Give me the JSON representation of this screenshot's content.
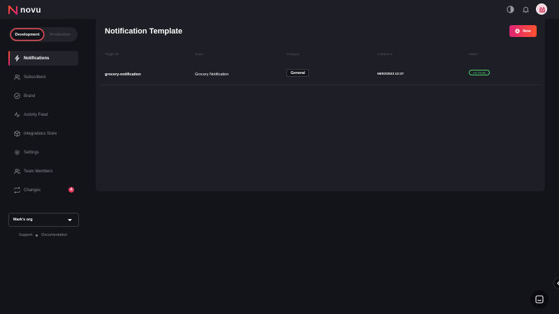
{
  "app": {
    "brand": "novu"
  },
  "header": {
    "icons": [
      "theme-toggle-icon",
      "bell-icon",
      "avatar"
    ]
  },
  "environment": {
    "options": [
      "Development",
      "Production"
    ],
    "selected": "Development"
  },
  "sidebar": {
    "items": [
      {
        "label": "Notifications",
        "icon": "lightning-icon",
        "active": true
      },
      {
        "label": "Subscribers",
        "icon": "users-icon"
      },
      {
        "label": "Brand",
        "icon": "check-circle-icon"
      },
      {
        "label": "Activity Feed",
        "icon": "activity-icon"
      },
      {
        "label": "Integrations Store",
        "icon": "box-icon"
      },
      {
        "label": "Settings",
        "icon": "gear-icon"
      },
      {
        "label": "Team Members",
        "icon": "team-icon"
      },
      {
        "label": "Changes",
        "icon": "swap-icon",
        "badge": "4"
      }
    ],
    "org": {
      "name": "Mark's org"
    },
    "footer": {
      "support": "Support",
      "documentation": "Documentation"
    }
  },
  "main": {
    "title": "Notification Template",
    "new_button": "New",
    "table": {
      "columns": [
        "Trigger ID",
        "Name",
        "Category",
        "Created At",
        "Status"
      ],
      "rows": [
        {
          "trigger_id": "grocery-notification",
          "name": "Grocery Notification",
          "category": "General",
          "created_at": "06/02/2023 12:37",
          "status": "ACTIVE"
        }
      ]
    }
  },
  "colors": {
    "accent_start": "#dd2476",
    "accent_end": "#ff512f",
    "status_active": "#4dd26e",
    "background": "#13131a",
    "panel": "#1e1e26"
  }
}
